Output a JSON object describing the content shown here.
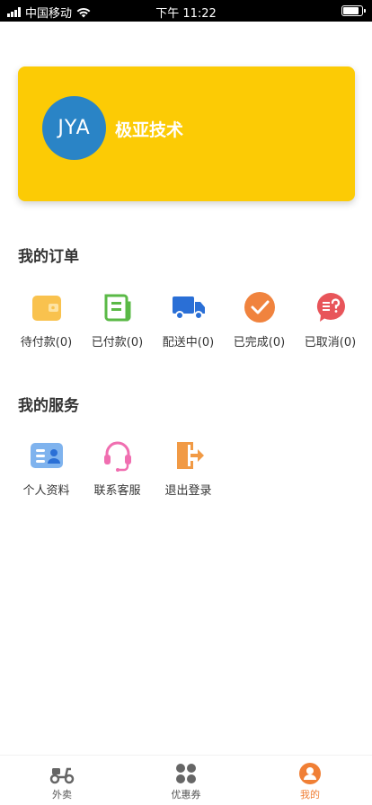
{
  "status_bar": {
    "carrier": "中国移动",
    "time": "下午 11:22"
  },
  "profile": {
    "avatar_text": "JYA",
    "name": "极亚技术"
  },
  "orders": {
    "title": "我的订单",
    "items": [
      {
        "label": "待付款(0)",
        "icon": "wallet-icon"
      },
      {
        "label": "已付款(0)",
        "icon": "receipt-icon"
      },
      {
        "label": "配送中(0)",
        "icon": "truck-icon"
      },
      {
        "label": "已完成(0)",
        "icon": "check-icon"
      },
      {
        "label": "已取消(0)",
        "icon": "cancel-bubble-icon"
      }
    ]
  },
  "services": {
    "title": "我的服务",
    "items": [
      {
        "label": "个人资料",
        "icon": "id-card-icon"
      },
      {
        "label": "联系客服",
        "icon": "headset-icon"
      },
      {
        "label": "退出登录",
        "icon": "logout-door-icon"
      }
    ]
  },
  "tab_bar": {
    "active": "我的",
    "tabs": [
      {
        "label": "外卖",
        "icon": "scooter-icon"
      },
      {
        "label": "优惠券",
        "icon": "grid-dots-icon"
      },
      {
        "label": "我的",
        "icon": "person-icon"
      }
    ]
  },
  "colors": {
    "brand_yellow": "#fccb05",
    "avatar_blue": "#2a84c6",
    "active_orange": "#f07f35"
  }
}
